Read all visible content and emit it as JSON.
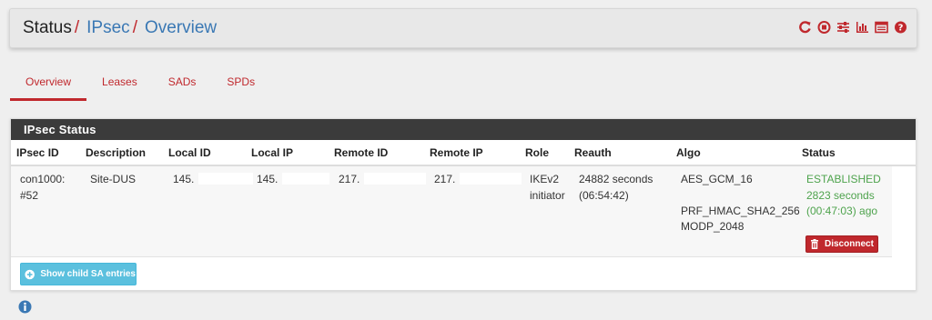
{
  "breadcrumb": {
    "root": "Status",
    "sep1": "/",
    "ipsec": "IPsec",
    "sep2": "/",
    "current": "Overview"
  },
  "header_icons": [
    "restart-service-icon",
    "stop-service-icon",
    "settings-sliders-icon",
    "graph-icon",
    "log-icon",
    "help-icon"
  ],
  "tabs": [
    "Overview",
    "Leases",
    "SADs",
    "SPDs"
  ],
  "active_tab": "Overview",
  "panel": {
    "title": "IPsec Status"
  },
  "table": {
    "headers": [
      "IPsec ID",
      "Description",
      "Local ID",
      "Local IP",
      "Remote ID",
      "Remote IP",
      "Role",
      "Reauth",
      "Algo",
      "Status"
    ],
    "row": {
      "ipsec_id_1": "con1000:",
      "ipsec_id_2": "#52",
      "description": "Site-DUS",
      "local_id": "145.",
      "local_ip": "145.",
      "remote_id": "217.",
      "remote_ip": "217.",
      "role_1": "IKEv2",
      "role_2": "initiator",
      "reauth_1": "24882 seconds",
      "reauth_2": "(06:54:42)",
      "algo_1": "AES_GCM_16",
      "algo_2": "PRF_HMAC_SHA2_256",
      "algo_3": "MODP_2048",
      "status_1": "ESTABLISHED",
      "status_2": "2823 seconds",
      "status_3": "(00:47:03) ago",
      "disconnect_label": "Disconnect"
    }
  },
  "show_child_label": "Show child SA entries",
  "colors": {
    "accent_red": "#c0282d",
    "link_blue": "#3a78b4",
    "established_green": "#4ea34d",
    "info_button": "#5bc0de",
    "panel_header": "#3b3b3b"
  }
}
